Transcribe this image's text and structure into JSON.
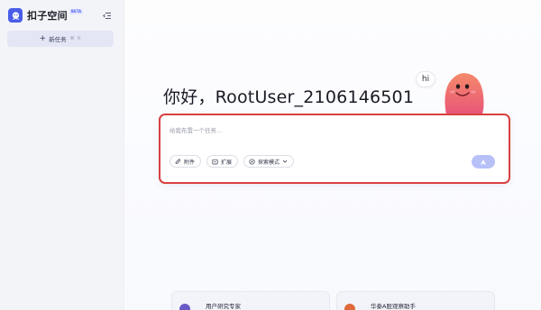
{
  "app": {
    "name": "扣子空间",
    "badge": "BETA"
  },
  "sidebar": {
    "new_task_label": "新任务",
    "new_task_shortcut": "⌘ K"
  },
  "main": {
    "greeting": "你好，RootUser_2106146501",
    "mascot_bubble": "hi"
  },
  "composer": {
    "placeholder": "给我布置一个任务...",
    "attach_label": "附件",
    "extend_label": "扩展",
    "mode_label": "探索模式",
    "send_label": "A"
  },
  "agents": [
    {
      "title": "用户研究专家",
      "avatar_color": "#6a5ac8"
    },
    {
      "title": "华泰A股观察助手",
      "avatar_color": "#e06a3a"
    }
  ],
  "colors": {
    "accent": "#4a5de8",
    "highlight_border": "#d84040",
    "send_button": "#b8c1f7"
  }
}
